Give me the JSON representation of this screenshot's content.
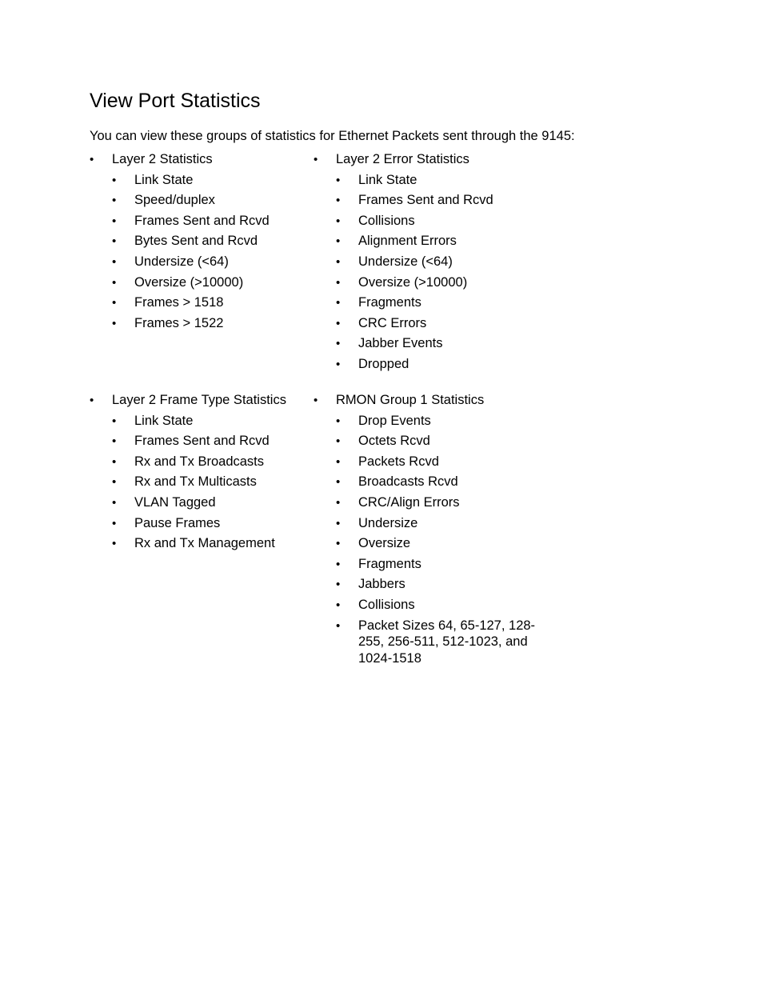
{
  "document": {
    "title": "View Port Statistics",
    "intro": "You can view these groups of statistics for Ethernet Packets sent through the 9145:",
    "groups": [
      {
        "label": "Layer 2 Statistics",
        "items": [
          "Link State",
          "Speed/duplex",
          "Frames Sent and Rcvd",
          "Bytes Sent and Rcvd",
          "Undersize (<64)",
          "Oversize (>10000)",
          "Frames > 1518",
          "Frames > 1522"
        ]
      },
      {
        "label": "Layer 2 Error Statistics",
        "items": [
          "Link State",
          "Frames Sent and Rcvd",
          "Collisions",
          "Alignment Errors",
          "Undersize (<64)",
          "Oversize (>10000)",
          "Fragments",
          "CRC Errors",
          "Jabber Events",
          "Dropped"
        ]
      },
      {
        "label": "Layer 2 Frame Type Statistics",
        "items": [
          "Link State",
          "Frames Sent and Rcvd",
          "Rx and Tx Broadcasts",
          "Rx and Tx Multicasts",
          "VLAN Tagged",
          "Pause Frames",
          "Rx and Tx Management"
        ]
      },
      {
        "label": "RMON Group 1 Statistics",
        "items": [
          "Drop Events",
          "Octets Rcvd",
          "Packets Rcvd",
          "Broadcasts Rcvd",
          "CRC/Align Errors",
          "Undersize",
          "Oversize",
          "Fragments",
          "Jabbers",
          "Collisions",
          "Packet Sizes 64, 65-127, 128-255, 256-511, 512-1023, and 1024-1518"
        ]
      }
    ]
  }
}
